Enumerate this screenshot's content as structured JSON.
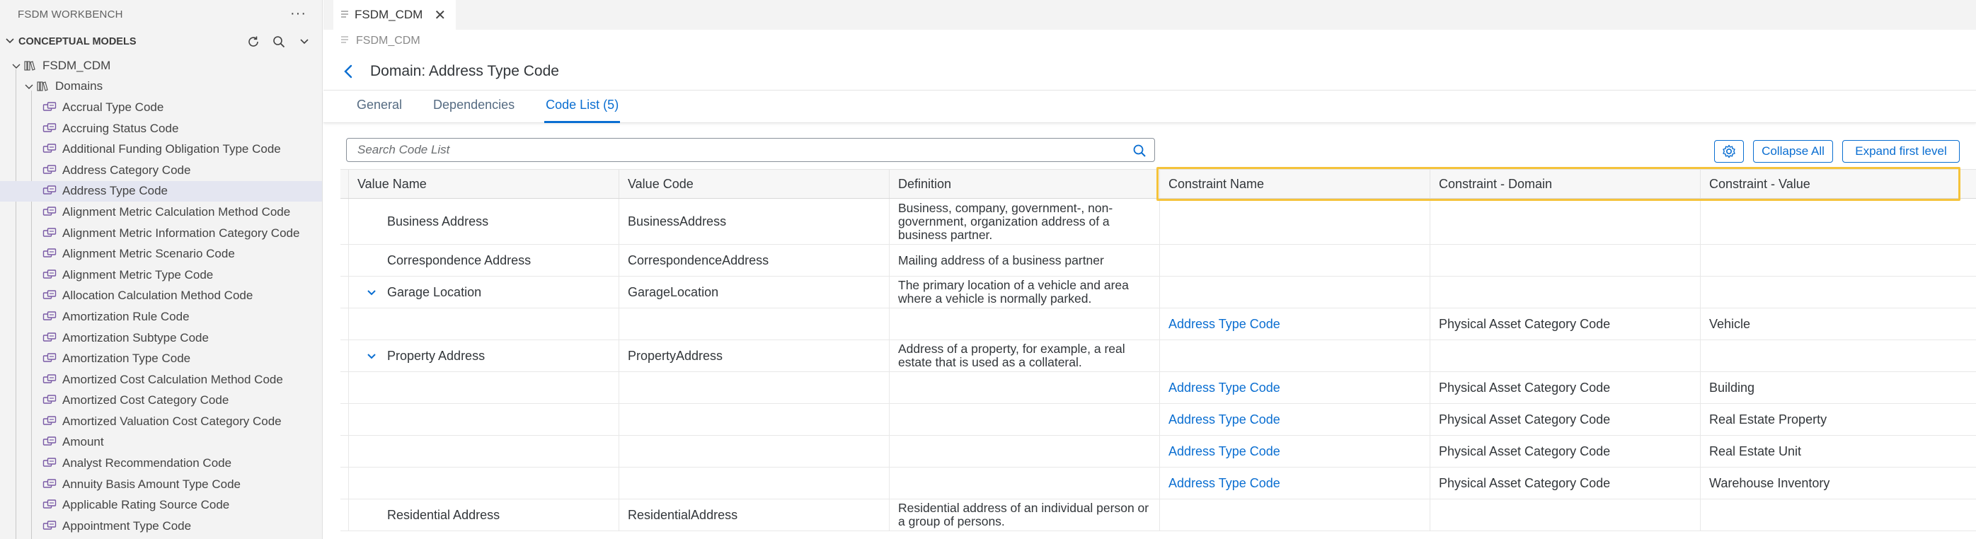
{
  "sidebar": {
    "header": "FSDM WORKBENCH",
    "more": "···",
    "section": "CONCEPTUAL MODELS",
    "model": "FSDM_CDM",
    "folder": "Domains",
    "items": [
      {
        "label": "Accrual Type Code"
      },
      {
        "label": "Accruing Status Code"
      },
      {
        "label": "Additional Funding Obligation Type Code"
      },
      {
        "label": "Address Category Code"
      },
      {
        "label": "Address Type Code",
        "selected": true
      },
      {
        "label": "Alignment Metric Calculation Method Code"
      },
      {
        "label": "Alignment Metric Information Category Code"
      },
      {
        "label": "Alignment Metric Scenario Code"
      },
      {
        "label": "Alignment Metric Type Code"
      },
      {
        "label": "Allocation Calculation Method Code"
      },
      {
        "label": "Amortization Rule Code"
      },
      {
        "label": "Amortization Subtype Code"
      },
      {
        "label": "Amortization Type Code"
      },
      {
        "label": "Amortized Cost Calculation Method Code"
      },
      {
        "label": "Amortized Cost Category Code"
      },
      {
        "label": "Amortized Valuation Cost Category Code"
      },
      {
        "label": "Amount"
      },
      {
        "label": "Analyst Recommendation Code"
      },
      {
        "label": "Annuity Basis Amount Type Code"
      },
      {
        "label": "Applicable Rating Source Code"
      },
      {
        "label": "Appointment Type Code"
      }
    ]
  },
  "editor": {
    "tab_label": "FSDM_CDM",
    "tab_close": "✕",
    "breadcrumb": "FSDM_CDM",
    "title": "Domain: Address Type Code",
    "subtabs": [
      "General",
      "Dependencies",
      "Code List (5)"
    ],
    "active_subtab": 2
  },
  "toolbar": {
    "search_placeholder": "Search Code List",
    "collapse_label": "Collapse All",
    "expand_label": "Expand first level"
  },
  "table": {
    "headers": [
      "Value Name",
      "Value Code",
      "Definition",
      "Constraint Name",
      "Constraint - Domain",
      "Constraint - Value"
    ],
    "rows": [
      {
        "kind": "parent",
        "expandable": false,
        "name": "Business Address",
        "code": "BusinessAddress",
        "definition": "Business, company, government-, non-government, organization address of a business partner.",
        "cname": "",
        "cdomain": "",
        "cvalue": ""
      },
      {
        "kind": "parent",
        "expandable": false,
        "name": "Correspondence Address",
        "code": "CorrespondenceAddress",
        "definition": "Mailing address of a business partner",
        "cname": "",
        "cdomain": "",
        "cvalue": ""
      },
      {
        "kind": "parent",
        "expandable": true,
        "name": "Garage Location",
        "code": "GarageLocation",
        "definition": "The primary location of a vehicle and area where a vehicle is normally parked.",
        "cname": "",
        "cdomain": "",
        "cvalue": ""
      },
      {
        "kind": "child",
        "name": "",
        "code": "",
        "definition": "",
        "cname": "Address Type Code",
        "cdomain": "Physical Asset Category Code",
        "cvalue": "Vehicle"
      },
      {
        "kind": "parent",
        "expandable": true,
        "name": "Property Address",
        "code": "PropertyAddress",
        "definition": "Address of a property, for example, a real estate that is used as a collateral.",
        "cname": "",
        "cdomain": "",
        "cvalue": ""
      },
      {
        "kind": "child",
        "name": "",
        "code": "",
        "definition": "",
        "cname": "Address Type Code",
        "cdomain": "Physical Asset Category Code",
        "cvalue": "Building"
      },
      {
        "kind": "child",
        "name": "",
        "code": "",
        "definition": "",
        "cname": "Address Type Code",
        "cdomain": "Physical Asset Category Code",
        "cvalue": "Real Estate Property"
      },
      {
        "kind": "child",
        "name": "",
        "code": "",
        "definition": "",
        "cname": "Address Type Code",
        "cdomain": "Physical Asset Category Code",
        "cvalue": "Real Estate Unit"
      },
      {
        "kind": "child",
        "name": "",
        "code": "",
        "definition": "",
        "cname": "Address Type Code",
        "cdomain": "Physical Asset Category Code",
        "cvalue": "Warehouse Inventory"
      },
      {
        "kind": "parent",
        "expandable": false,
        "name": "Residential Address",
        "code": "ResidentialAddress",
        "definition": "Residential address of an individual person or a group of persons.",
        "cname": "",
        "cdomain": "",
        "cvalue": ""
      }
    ]
  },
  "colors": {
    "accent": "#0a6ed1",
    "highlight": "#f5c33b",
    "selected_row": "#e4e6f1"
  }
}
